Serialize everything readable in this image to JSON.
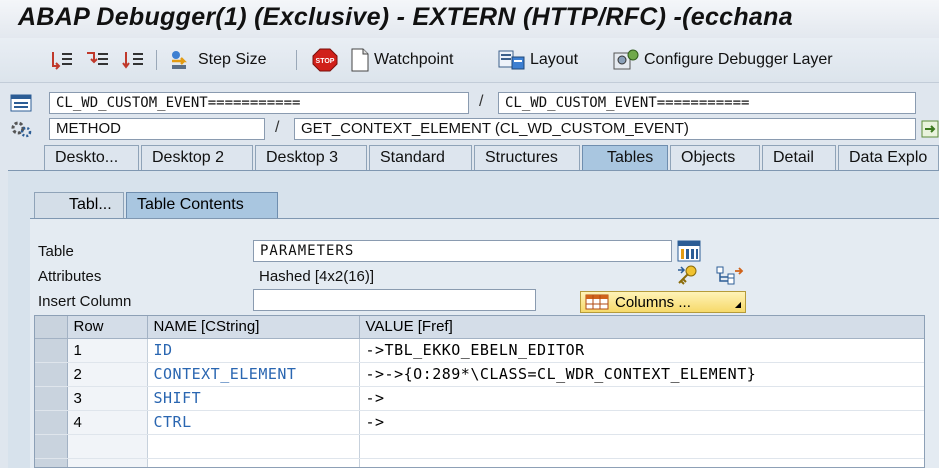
{
  "window": {
    "title": "ABAP Debugger(1)  (Exclusive) - EXTERN (HTTP/RFC) -(ecchana"
  },
  "toolbar": {
    "step_size_label": "Step Size",
    "watchpoint_label": "Watchpoint",
    "layout_label": "Layout",
    "configure_label": "Configure Debugger Layer"
  },
  "location": {
    "program": "CL_WD_CUSTOM_EVENT===========",
    "include": "CL_WD_CUSTOM_EVENT===========",
    "kind": "METHOD",
    "event": "GET_CONTEXT_ELEMENT (CL_WD_CUSTOM_EVENT)",
    "separator": "/"
  },
  "tabs": [
    "Deskto...",
    "Desktop 2",
    "Desktop 3",
    "Standard",
    "Structures",
    "Tables",
    "Objects",
    "Detail",
    "Data Explo"
  ],
  "active_tab": "Tables",
  "subtabs": [
    "Tabl...",
    "Table Contents"
  ],
  "table_view": {
    "table_label": "Table",
    "table_value": "PARAMETERS",
    "attributes_label": "Attributes",
    "attributes_value": "Hashed [4x2(16)]",
    "insert_column_label": "Insert Column",
    "insert_column_value": "",
    "columns_button": "Columns ..."
  },
  "grid": {
    "headers": [
      "Row",
      "NAME [CString]",
      "VALUE [Fref]"
    ],
    "rows": [
      {
        "row": "1",
        "name": "ID",
        "value": "->TBL_EKKO_EBELN_EDITOR"
      },
      {
        "row": "2",
        "name": "CONTEXT_ELEMENT",
        "value": "->->{O:289*\\CLASS=CL_WDR_CONTEXT_ELEMENT}"
      },
      {
        "row": "3",
        "name": "SHIFT",
        "value": "->"
      },
      {
        "row": "4",
        "name": "CTRL",
        "value": "->"
      }
    ]
  }
}
